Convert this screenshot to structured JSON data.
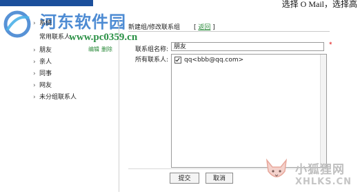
{
  "top_right_text": "选择 O Mail，选择高",
  "watermark": {
    "site_title": "河东软件园",
    "site_url": "www.pc0359.cn",
    "corner_cn": "小狐狸网",
    "corner_en": "XHLKS.CN"
  },
  "sidebar": {
    "items": [
      {
        "label": "系统"
      },
      {
        "label": "常用联系人"
      },
      {
        "label": "朋友"
      },
      {
        "label": "亲人"
      },
      {
        "label": "同事"
      },
      {
        "label": "网友"
      },
      {
        "label": "未分组联系人"
      }
    ],
    "edit_label": "编辑",
    "delete_label": "删除"
  },
  "panel": {
    "title": "新建组/修改联系组",
    "back_label": "返回",
    "group_name_label": "联系组名称:",
    "group_name_value": "朋友",
    "required_mark": "*",
    "contacts_label": "所有联系人:",
    "contacts": [
      {
        "label": "qq<bbb@qq.com>",
        "checked": true
      }
    ]
  },
  "buttons": {
    "submit": "提交",
    "cancel": "取消"
  }
}
